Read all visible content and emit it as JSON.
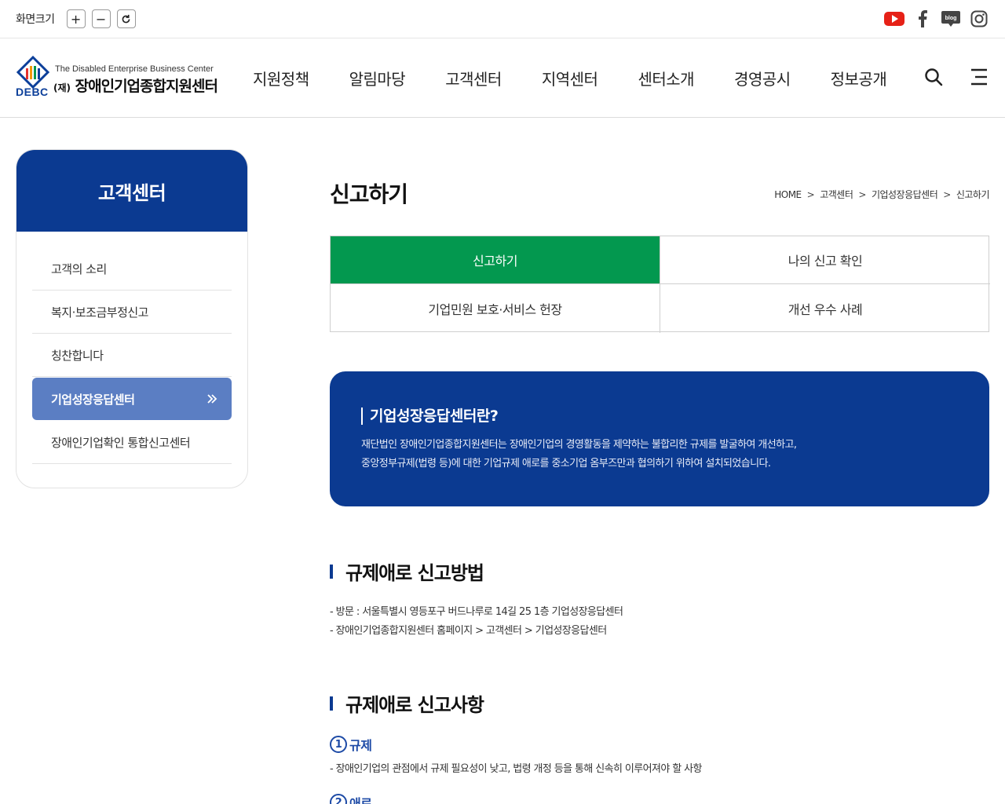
{
  "util": {
    "zoom_label": "화면크기",
    "zoom_in": "+",
    "zoom_out": "−",
    "zoom_reset": "↻",
    "social": [
      "youtube-icon",
      "facebook-icon",
      "blog-icon",
      "instagram-icon"
    ],
    "blog_text": "blog"
  },
  "header": {
    "logo_en": "The Disabled Enterprise Business Center",
    "logo_ko_prefix": "(재)",
    "logo_ko": "장애인기업종합지원센터",
    "logo_abbr": "DEBC",
    "nav": [
      "지원정책",
      "알림마당",
      "고객센터",
      "지역센터",
      "센터소개",
      "경영공시",
      "정보공개"
    ]
  },
  "sidebar": {
    "title": "고객센터",
    "items": [
      {
        "label": "고객의 소리",
        "active": false
      },
      {
        "label": "복지·보조금부정신고",
        "active": false
      },
      {
        "label": "칭찬합니다",
        "active": false
      },
      {
        "label": "기업성장응답센터",
        "active": true
      },
      {
        "label": "장애인기업확인 통합신고센터",
        "active": false
      }
    ]
  },
  "main": {
    "title": "신고하기",
    "breadcrumb": [
      "HOME",
      "고객센터",
      "기업성장응답센터",
      "신고하기"
    ],
    "breadcrumb_sep": ">",
    "tabs": [
      "신고하기",
      "나의 신고 확인",
      "기업민원 보호·서비스 헌장",
      "개선 우수 사례"
    ],
    "intro": {
      "title": "기업성장응답센터란?",
      "line1": "재단법인 장애인기업종합지원센터는 장애인기업의 경영활동을 제약하는 불합리한 규제를 발굴하여 개선하고,",
      "line2": "중앙정부규제(법령 등)에 대한 기업규제 애로를 중소기업 옴부즈만과 협의하기 위하여 설치되었습니다."
    },
    "method": {
      "title": "규제애로 신고방법",
      "lines": [
        "- 방문 : 서울특별시 영등포구 버드나루로 14길 25 1층 기업성장응답센터",
        "- 장애인기업종합지원센터 홈페이지 > 고객센터 > 기업성장응답센터"
      ]
    },
    "items": {
      "title": "규제애로 신고사항",
      "sub1_num": "1",
      "sub1_title": "규제",
      "sub1_line": "- 장애인기업의 관점에서 규제 필요성이 낮고, 법령 개정 등을 통해 신속히 이루어져야 할 사항",
      "sub2_num": "2",
      "sub2_title": "애로"
    }
  },
  "colors": {
    "brand_navy": "#0b3a91",
    "tab_active_green": "#03984f",
    "sidebar_active": "#5b7ec3"
  }
}
